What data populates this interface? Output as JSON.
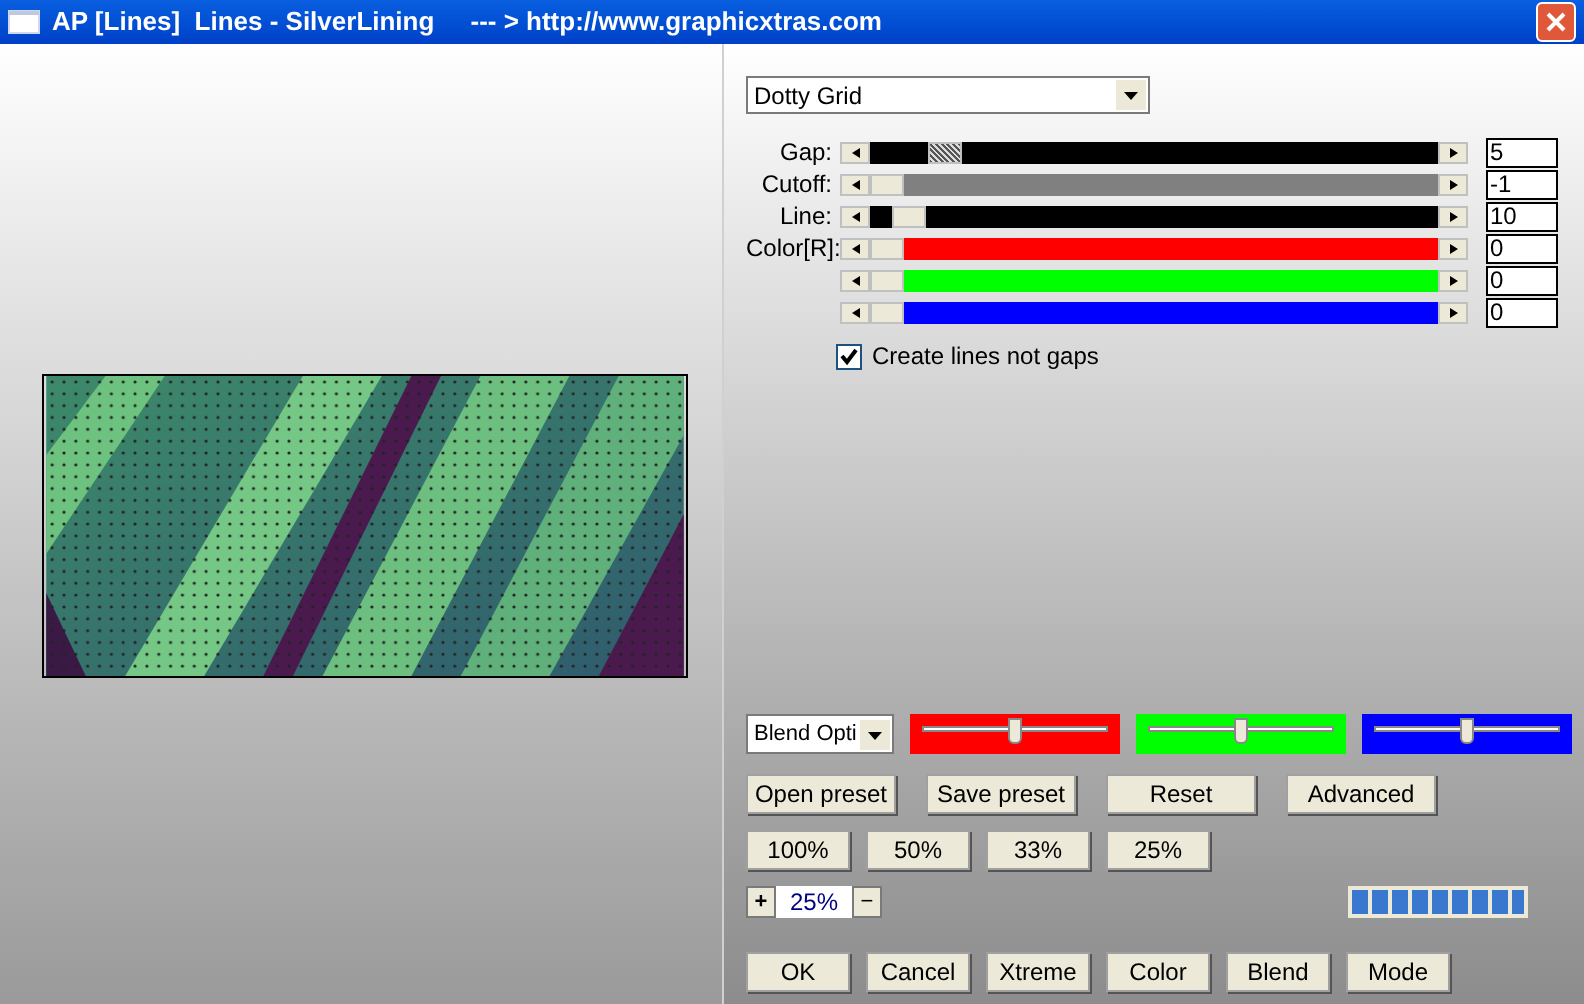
{
  "window": {
    "title": "AP [Lines]  Lines - SilverLining     --- > http://www.graphicxtras.com"
  },
  "preset_dropdown": {
    "value": "Dotty Grid"
  },
  "sliders": [
    {
      "label": "Gap:",
      "kind": "dark",
      "level": 0.11,
      "focused": true,
      "value": "5"
    },
    {
      "label": "Cutoff:",
      "kind": "gray",
      "level": 0,
      "focused": false,
      "value": "-1"
    },
    {
      "label": "Line:",
      "kind": "dark",
      "level": 0.04,
      "focused": false,
      "value": "10"
    },
    {
      "label": "Color[R]:",
      "kind": "red",
      "level": 0,
      "focused": false,
      "value": "0"
    },
    {
      "kind": "green",
      "level": 0,
      "focused": false,
      "value": "0"
    },
    {
      "kind": "blue",
      "level": 0,
      "focused": false,
      "value": "0"
    }
  ],
  "create_lines_checkbox": {
    "label": "Create lines not gaps",
    "checked": true
  },
  "blend_dropdown": {
    "value": "Blend Opti"
  },
  "blend_sliders": [
    {
      "color": "#ff0000",
      "level": 0.5
    },
    {
      "color": "#00ff00",
      "level": 0.5
    },
    {
      "color": "#0000ff",
      "level": 0.5
    }
  ],
  "preset_buttons": [
    "Open preset",
    "Save preset",
    "Reset",
    "Advanced"
  ],
  "zoom_buttons": [
    "100%",
    "50%",
    "33%",
    "25%"
  ],
  "zoom": {
    "plus": "+",
    "value": "25%",
    "minus": "−"
  },
  "progress": {
    "level": 1
  },
  "action_buttons": [
    "OK",
    "Cancel",
    "Xtreme",
    "Color",
    "Blend",
    "Mode"
  ]
}
